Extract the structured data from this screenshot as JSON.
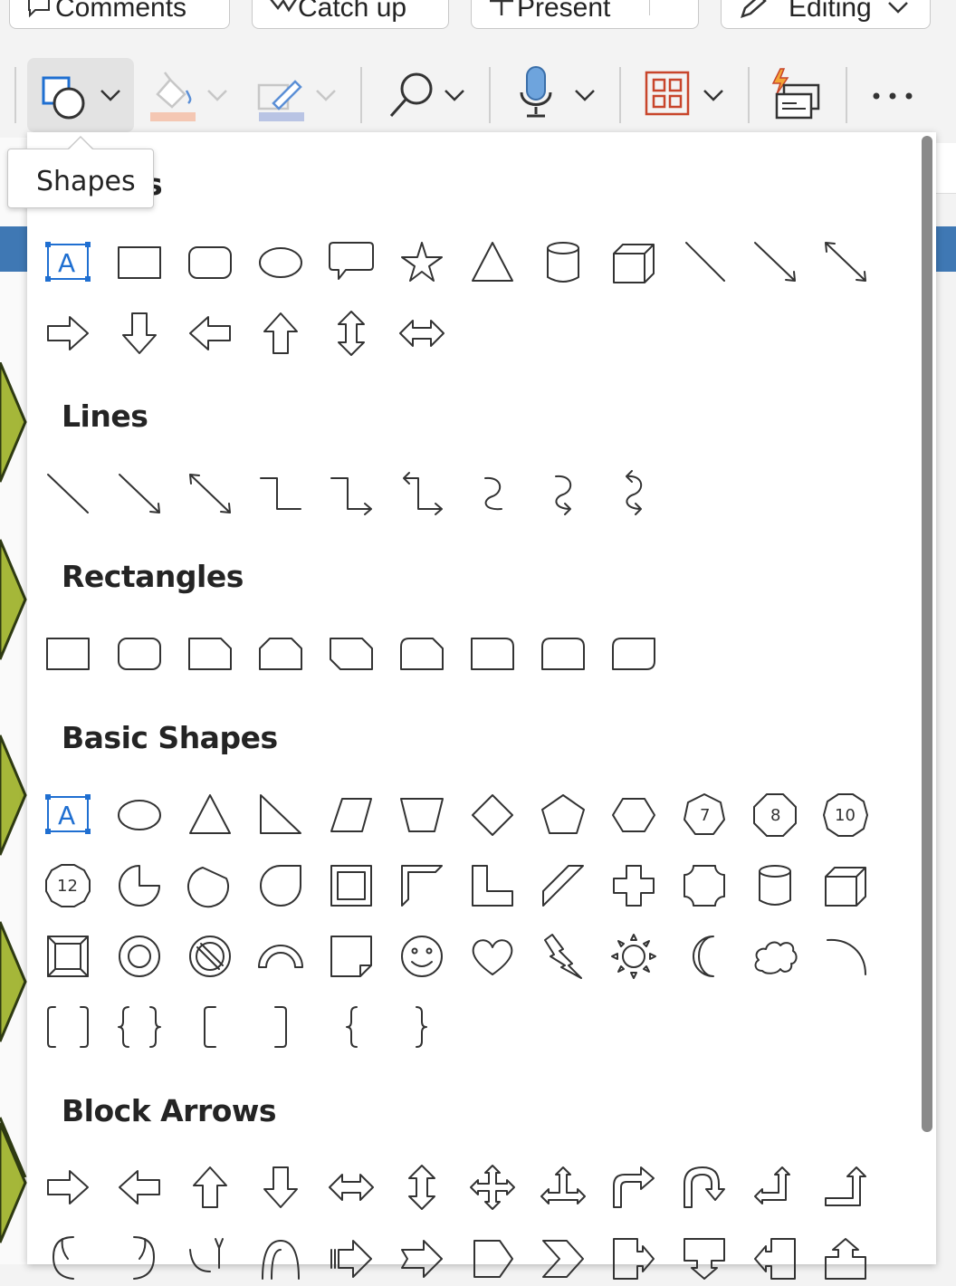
{
  "topbar": {
    "comments_label": "Comments",
    "catchup_label": "Catch up",
    "present_label": "Present",
    "editing_label": "Editing"
  },
  "ribbon": {
    "items": [
      {
        "name": "shapes",
        "icon": "shapes-icon"
      },
      {
        "name": "fill",
        "icon": "paint-bucket-icon"
      },
      {
        "name": "outline",
        "icon": "pen-outline-icon"
      },
      {
        "name": "find",
        "icon": "search-icon"
      },
      {
        "name": "dictate",
        "icon": "microphone-icon"
      },
      {
        "name": "add-ins",
        "icon": "grid-icon"
      },
      {
        "name": "designer",
        "icon": "designer-icon"
      },
      {
        "name": "more",
        "icon": "ellipsis-icon"
      }
    ]
  },
  "tooltip": {
    "text": "Shapes"
  },
  "panel": {
    "recent_title_fragment": "s",
    "sections": [
      {
        "id": "lines",
        "title": "Lines"
      },
      {
        "id": "rectangles",
        "title": "Rectangles"
      },
      {
        "id": "basic",
        "title": "Basic Shapes"
      },
      {
        "id": "block-arrows",
        "title": "Block Arrows"
      }
    ],
    "octagon_labels": [
      "7",
      "8",
      "10",
      "12"
    ],
    "textbox_letter": "A"
  },
  "colors": {
    "accent_blue": "#1f6fd1",
    "doc_band": "#3f78b4",
    "chevron_green": "#a5b739",
    "fill_swatch": "#f4c7b3",
    "outline_swatch": "#b9c4e4",
    "addins_red": "#c8452b"
  }
}
